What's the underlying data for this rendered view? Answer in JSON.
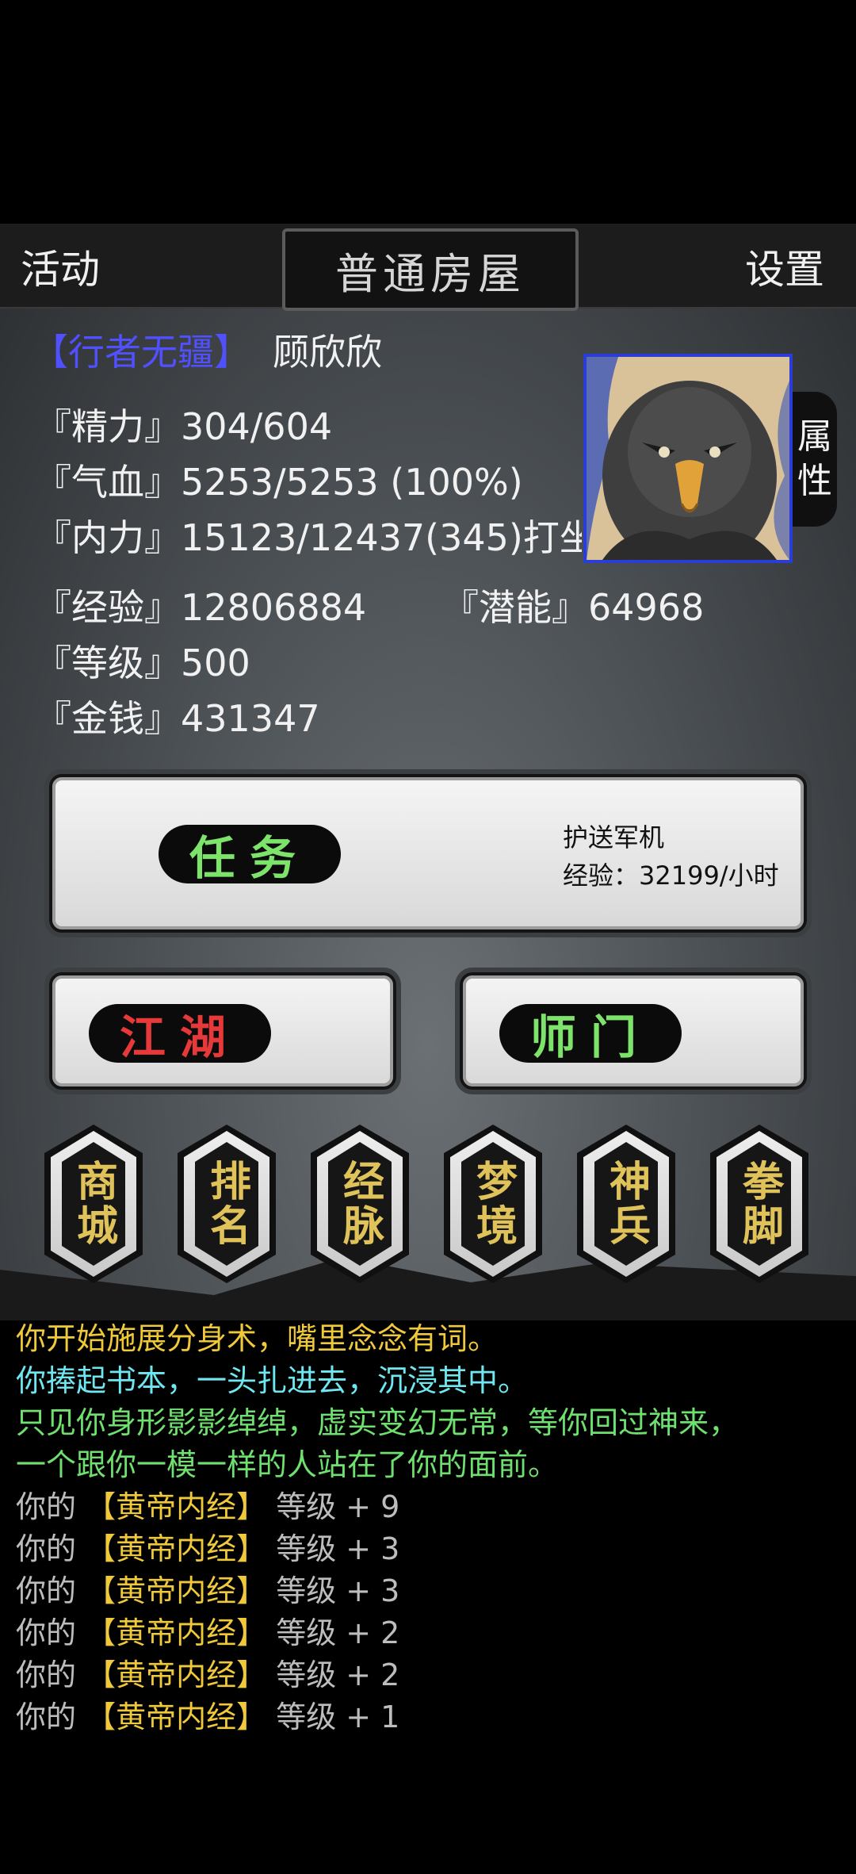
{
  "header": {
    "activity": "活动",
    "location": "普通房屋",
    "settings": "设置"
  },
  "profile": {
    "title": "【行者无疆】",
    "name": "顾欣欣",
    "stats": {
      "energy": "『精力』304/604",
      "health": "『气血』5253/5253 (100%)",
      "inner": "『内力』15123/12437(345)打坐",
      "exp": "『经验』12806884",
      "potential": "『潜能』64968",
      "level": "『等级』500",
      "money": "『金钱』431347"
    },
    "attr_tab": [
      "属",
      "性"
    ]
  },
  "quest": {
    "label": "任务",
    "name": "护送军机",
    "rate": "经验：32199/小时"
  },
  "jianghu": {
    "label": "江湖"
  },
  "sect": {
    "label": "师门"
  },
  "menu": [
    "商城",
    "排名",
    "经脉",
    "梦境",
    "神兵",
    "拳脚"
  ],
  "log": [
    {
      "text": "你开始施展分身术，嘴里念念有词。",
      "color": "#f0c93a"
    },
    {
      "text": "你捧起书本，一头扎进去，沉浸其中。",
      "color": "#6fe7f0"
    },
    {
      "text": "只见你身形影影绰绰，虚实变幻无常，等你回过神来，",
      "color": "#6fe06f"
    },
    {
      "text": "一个跟你一模一样的人站在了你的面前。",
      "color": "#6fe06f"
    },
    {
      "text": "你的 【黄帝内经】 等级 + 9",
      "color": "#bdbdbd",
      "skill_color": "#f0c93a"
    },
    {
      "text": "你的 【黄帝内经】 等级 + 3",
      "color": "#bdbdbd"
    },
    {
      "text": "你的 【黄帝内经】 等级 + 3",
      "color": "#bdbdbd"
    },
    {
      "text": "你的 【黄帝内经】 等级 + 2",
      "color": "#bdbdbd"
    },
    {
      "text": "你的 【黄帝内经】 等级 + 2",
      "color": "#bdbdbd"
    },
    {
      "text": "你的 【黄帝内经】 等级 + 1",
      "color": "#bdbdbd"
    }
  ],
  "log_parts": [
    {
      "pre": "你的 ",
      "skill": "【黄帝内经】",
      "post": " 等级 + 9"
    },
    {
      "pre": "你的 ",
      "skill": "【黄帝内经】",
      "post": " 等级 + 3"
    },
    {
      "pre": "你的 ",
      "skill": "【黄帝内经】",
      "post": " 等级 + 3"
    },
    {
      "pre": "你的 ",
      "skill": "【黄帝内经】",
      "post": " 等级 + 2"
    },
    {
      "pre": "你的 ",
      "skill": "【黄帝内经】",
      "post": " 等级 + 2"
    },
    {
      "pre": "你的 ",
      "skill": "【黄帝内经】",
      "post": " 等级 + 1"
    }
  ],
  "colors": {
    "title_badge": "#5050ff",
    "quest_green": "#7ee36b",
    "jianghu_red": "#e63a3a",
    "sect_green": "#7ee36b",
    "menu_gold": "#e0c25a",
    "avatar_border": "#2a3dd6"
  }
}
